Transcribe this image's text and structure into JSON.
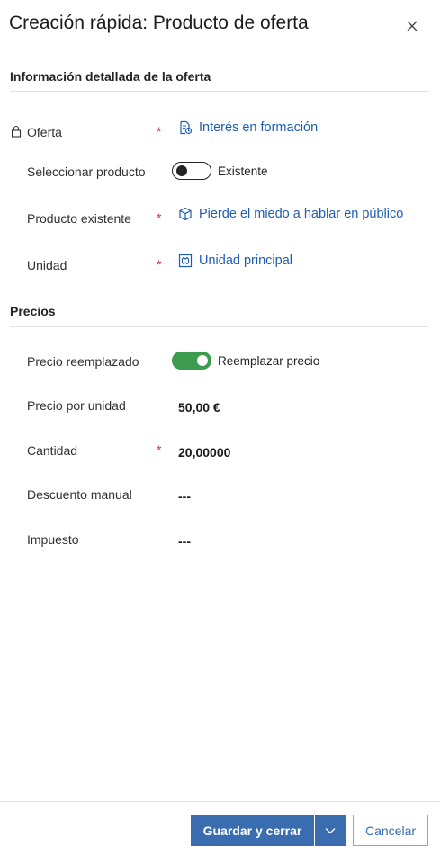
{
  "header": {
    "title": "Creación rápida: Producto de oferta"
  },
  "sections": {
    "detail": {
      "title": "Información detallada de la oferta"
    },
    "pricing": {
      "title": "Precios"
    }
  },
  "fields": {
    "oferta": {
      "label": "Oferta",
      "required": "*",
      "value": "Interés en formación",
      "icon": "quote-icon"
    },
    "seleccionar": {
      "label": "Seleccionar producto",
      "toggle_text": "Existente",
      "state": "off"
    },
    "producto": {
      "label": "Producto existente",
      "required": "*",
      "value": "Pierde el miedo a hablar en público",
      "icon": "cube-icon"
    },
    "unidad": {
      "label": "Unidad",
      "required": "*",
      "value": "Unidad principal",
      "icon": "unit-icon"
    },
    "precio_reemplazado": {
      "label": "Precio reemplazado",
      "toggle_text": "Reemplazar precio",
      "state": "on"
    },
    "precio_unidad": {
      "label": "Precio por unidad",
      "value": "50,00 €"
    },
    "cantidad": {
      "label": "Cantidad",
      "required": "*",
      "value": "20,00000"
    },
    "descuento": {
      "label": "Descuento manual",
      "value": "---"
    },
    "impuesto": {
      "label": "Impuesto",
      "value": "---"
    }
  },
  "footer": {
    "save_label": "Guardar y cerrar",
    "cancel_label": "Cancelar"
  },
  "colors": {
    "link": "#1f5db4",
    "primary": "#3a6db0",
    "toggle_on": "#3c9b4e",
    "required": "#c4314b"
  }
}
